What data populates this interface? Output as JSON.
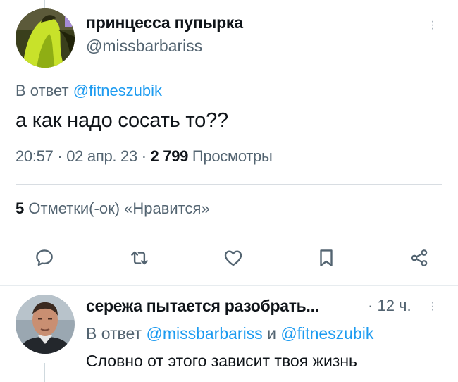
{
  "tweet": {
    "author_name": "принцесса пупырка",
    "author_handle": "@missbarbariss",
    "reply_prefix": "В ответ",
    "reply_mention": "@fitneszubik",
    "text": "а как надо сосать то??",
    "time": "20:57",
    "date": "02 апр. 23",
    "separator": "·",
    "views_count": "2 799",
    "views_label": "Просмотры",
    "likes_count": "5",
    "likes_label": "Отметки(-ок) «Нравится»",
    "more_icon": "more-vertical-icon"
  },
  "actions": [
    {
      "name": "reply",
      "icon": "comment-icon"
    },
    {
      "name": "retweet",
      "icon": "retweet-icon"
    },
    {
      "name": "like",
      "icon": "heart-icon"
    },
    {
      "name": "bookmark",
      "icon": "bookmark-icon"
    },
    {
      "name": "share",
      "icon": "share-icon"
    }
  ],
  "reply": {
    "author_name": "сережа пытается разобрать...",
    "separator": "·",
    "time": "12 ч.",
    "reply_prefix": "В ответ",
    "mention_1": "@missbarbariss",
    "conjunction": "и",
    "mention_2": "@fitneszubik",
    "text": "Словно от этого зависит твоя жизнь"
  },
  "colors": {
    "accent": "#1d9bf0",
    "text": "#0f1419",
    "secondary": "#536471",
    "divider": "#d8dde2"
  }
}
